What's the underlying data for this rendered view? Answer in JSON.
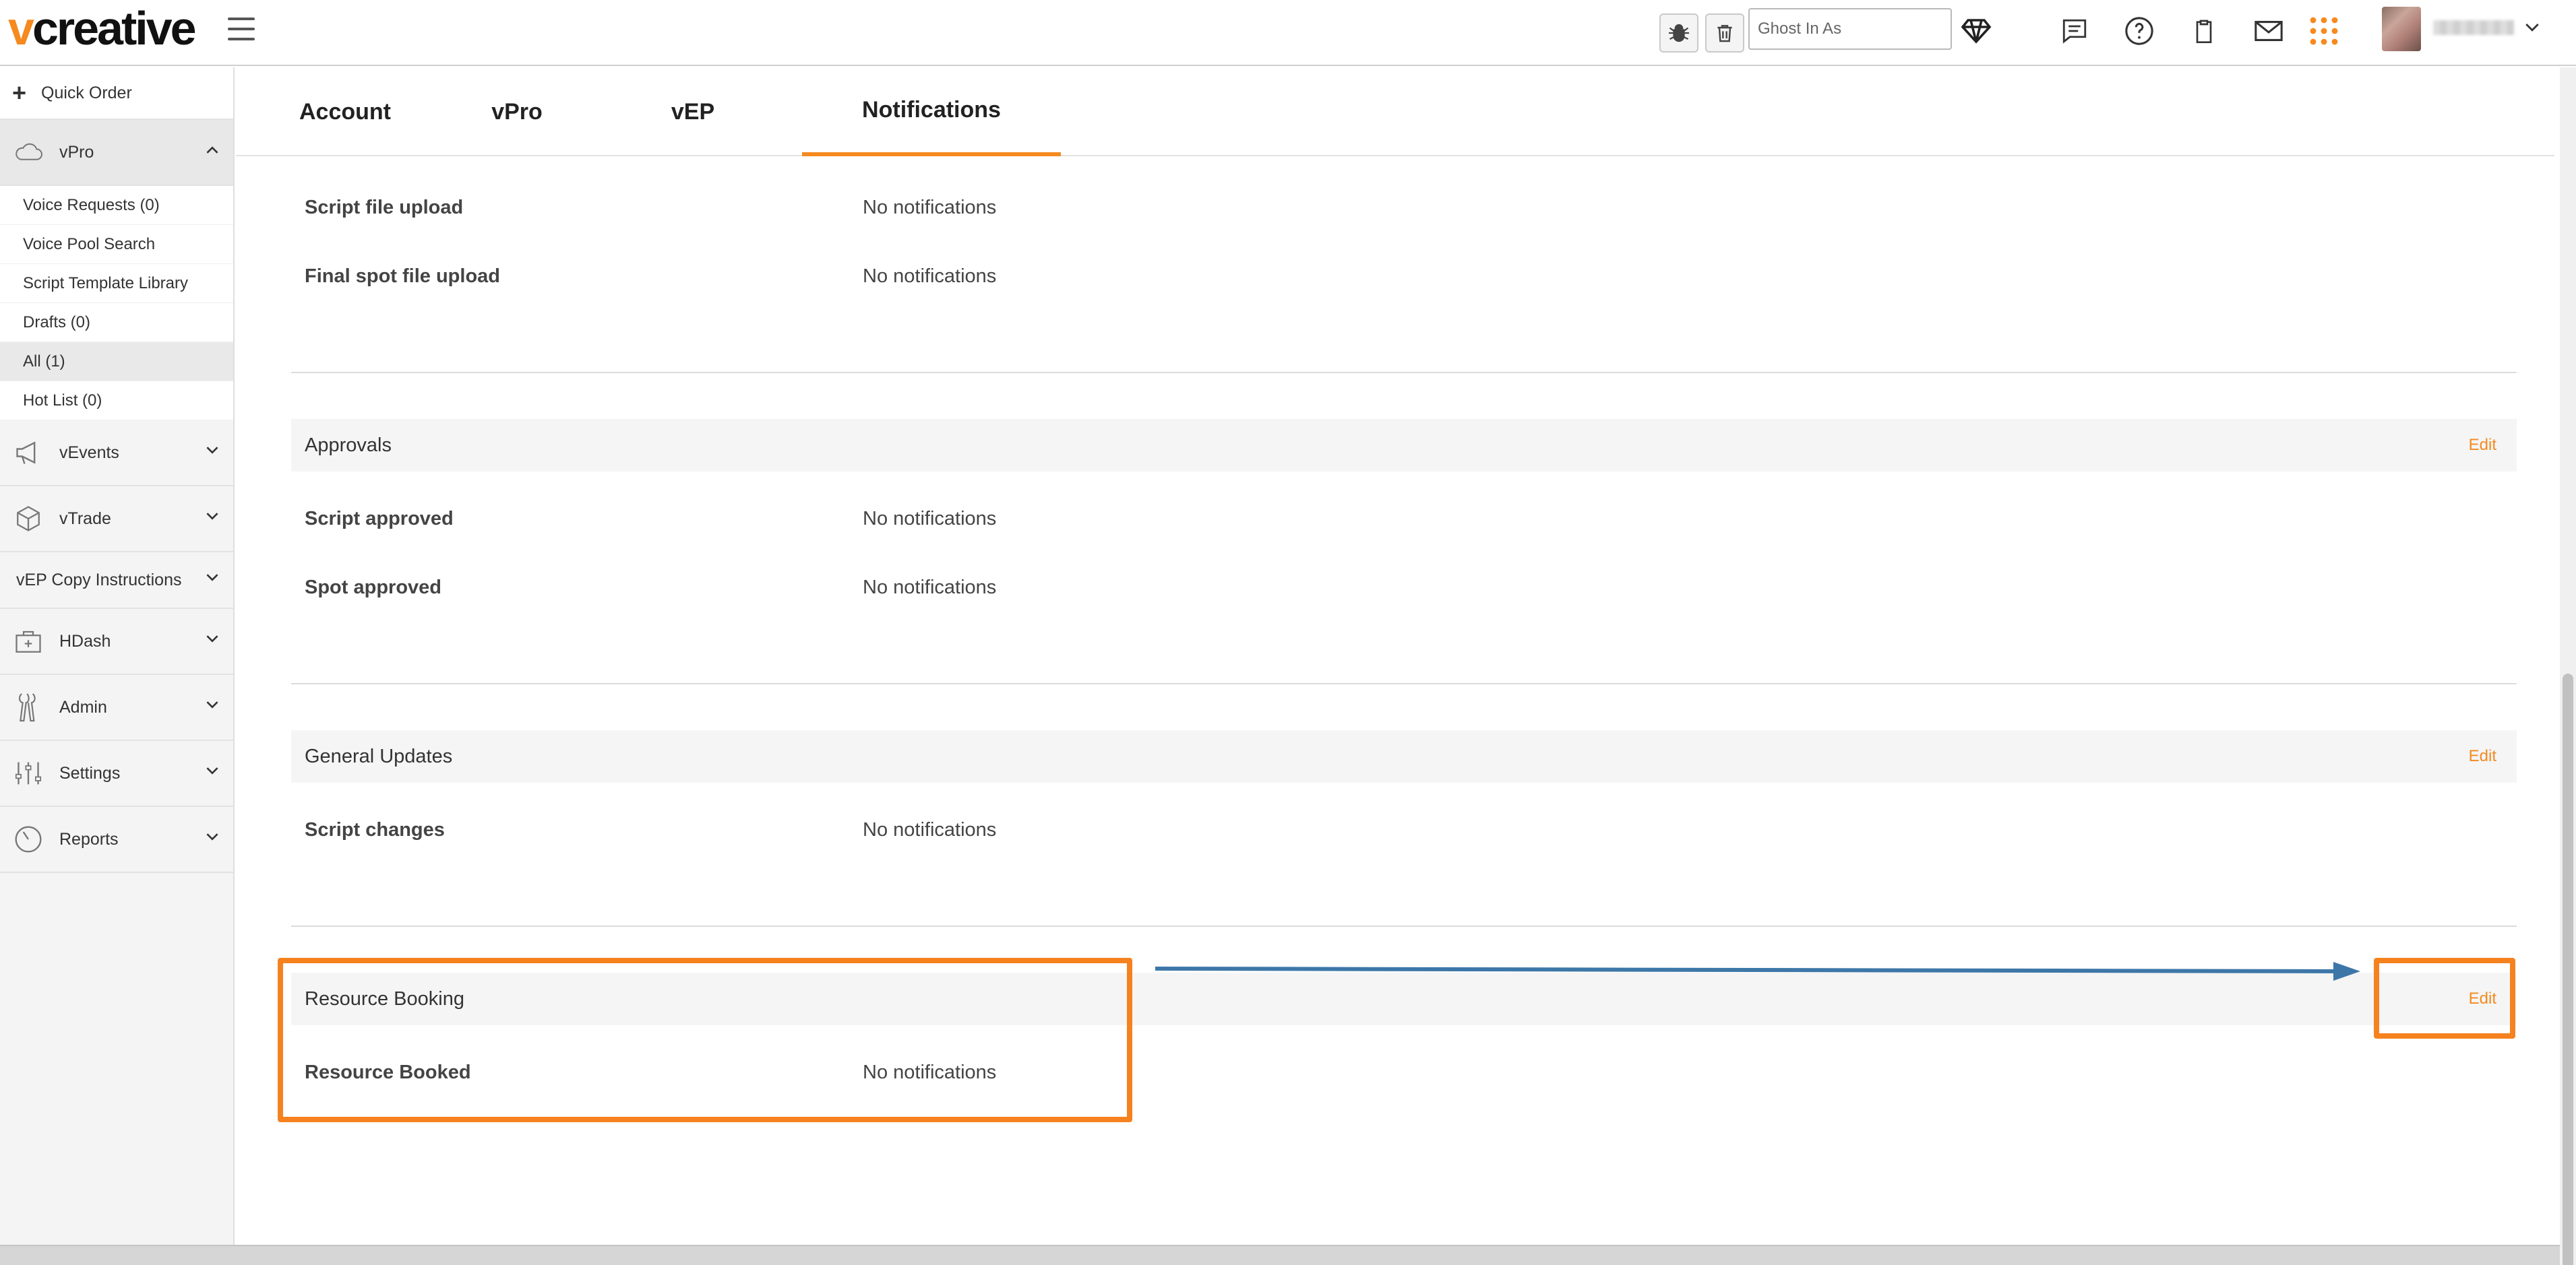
{
  "app": {
    "logo_accent": "v",
    "logo_rest": "creative",
    "brand_color": "#f58a1f"
  },
  "topbar": {
    "ghost_placeholder": "Ghost In As",
    "icons": [
      "bug-icon",
      "trash-icon",
      "diamond-icon",
      "chat-icon",
      "help-icon",
      "clipboard-icon",
      "mail-icon",
      "apps-grid-icon",
      "chevron-down-icon"
    ]
  },
  "sidebar": {
    "quick_order": "Quick Order",
    "groups": [
      {
        "label": "vPro",
        "expanded": true
      },
      {
        "label": "vEvents"
      },
      {
        "label": "vTrade"
      },
      {
        "label": "vEP Copy Instructions"
      },
      {
        "label": "HDash"
      },
      {
        "label": "Admin"
      },
      {
        "label": "Settings"
      },
      {
        "label": "Reports"
      }
    ],
    "vpro_items": [
      {
        "label": "Voice Requests (0)"
      },
      {
        "label": "Voice Pool Search"
      },
      {
        "label": "Script Template Library"
      },
      {
        "label": "Drafts (0)"
      },
      {
        "label": "All (1)",
        "selected": true
      },
      {
        "label": "Hot List (0)"
      }
    ]
  },
  "tabs": [
    {
      "label": "Account"
    },
    {
      "label": "vPro"
    },
    {
      "label": "vEP"
    },
    {
      "label": "Notifications",
      "active": true
    }
  ],
  "sections": {
    "uploads": {
      "rows": [
        {
          "label": "Script file upload",
          "value": "No notifications"
        },
        {
          "label": "Final spot file upload",
          "value": "No notifications"
        }
      ]
    },
    "approvals": {
      "title": "Approvals",
      "edit": "Edit",
      "rows": [
        {
          "label": "Script approved",
          "value": "No notifications"
        },
        {
          "label": "Spot approved",
          "value": "No notifications"
        }
      ]
    },
    "general_updates": {
      "title": "General Updates",
      "edit": "Edit",
      "rows": [
        {
          "label": "Script changes",
          "value": "No notifications"
        }
      ]
    },
    "resource_booking": {
      "title": "Resource Booking",
      "edit": "Edit",
      "rows": [
        {
          "label": "Resource Booked",
          "value": "No notifications"
        }
      ]
    }
  },
  "annotation": {
    "box_color": "#f5821f",
    "arrow_color": "#3d77a8"
  }
}
